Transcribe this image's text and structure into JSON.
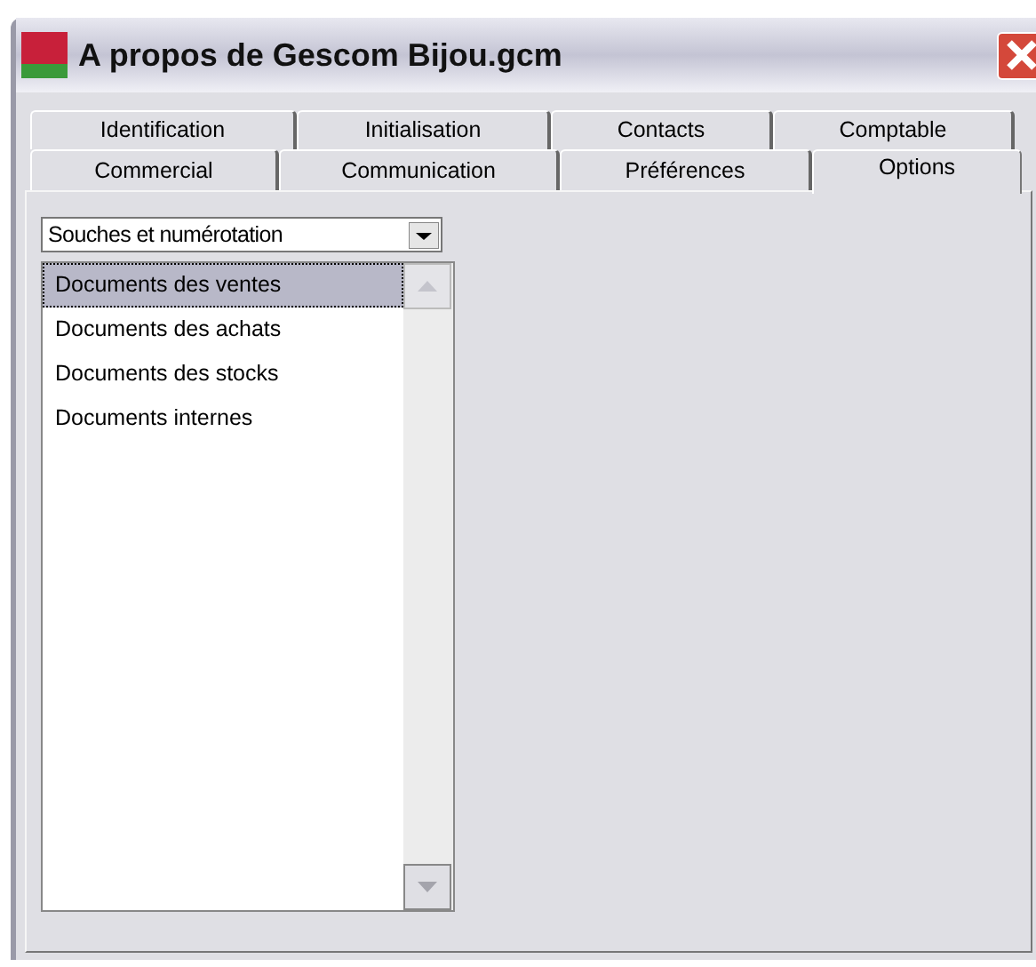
{
  "window": {
    "title": "A propos de Gescom Bijou.gcm"
  },
  "tab_rows": [
    [
      {
        "label": "Identification",
        "selected": false
      },
      {
        "label": "Initialisation",
        "selected": false
      },
      {
        "label": "Contacts",
        "selected": false
      },
      {
        "label": "Comptable",
        "selected": false
      }
    ],
    [
      {
        "label": "Commercial",
        "selected": false
      },
      {
        "label": "Communication",
        "selected": false
      },
      {
        "label": "Préférences",
        "selected": false
      },
      {
        "label": "Options",
        "selected": true
      }
    ]
  ],
  "dropdown": {
    "value": "Souches et numérotation"
  },
  "list": {
    "items": [
      {
        "label": "Documents des ventes",
        "selected": true
      },
      {
        "label": "Documents des achats",
        "selected": false
      },
      {
        "label": "Documents des stocks",
        "selected": false
      },
      {
        "label": "Documents internes",
        "selected": false
      }
    ]
  }
}
